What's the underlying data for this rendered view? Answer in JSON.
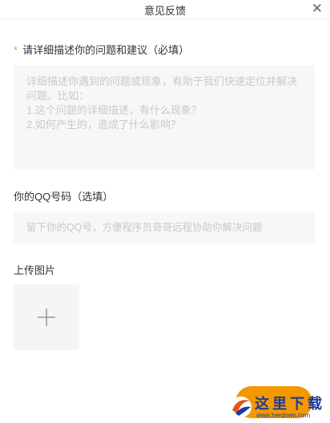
{
  "window": {
    "title": "意见反馈",
    "close_glyph": "✕"
  },
  "feedback": {
    "required_mark": "*",
    "label": "请详细描述你的问题和建议（必填）",
    "placeholder": "详细描述你遇到的问题或现象，有助于我们快速定位并解决问题。比如：\n1.这个问题的详细描述，有什么现象？\n2.如何产生的，造成了什么影响？"
  },
  "qq": {
    "label": "你的QQ号码（选填）",
    "placeholder": "留下你的QQ号，方便程序员哥哥远程协助你解决问题"
  },
  "upload": {
    "label": "上传图片",
    "icon": "plus-icon"
  },
  "watermark": {
    "text": "这里下载",
    "url": "www.herdown.com"
  },
  "colors": {
    "accent": "#f39800",
    "placeholder": "#c9c9c9",
    "field_bg": "#f7f7f7"
  }
}
